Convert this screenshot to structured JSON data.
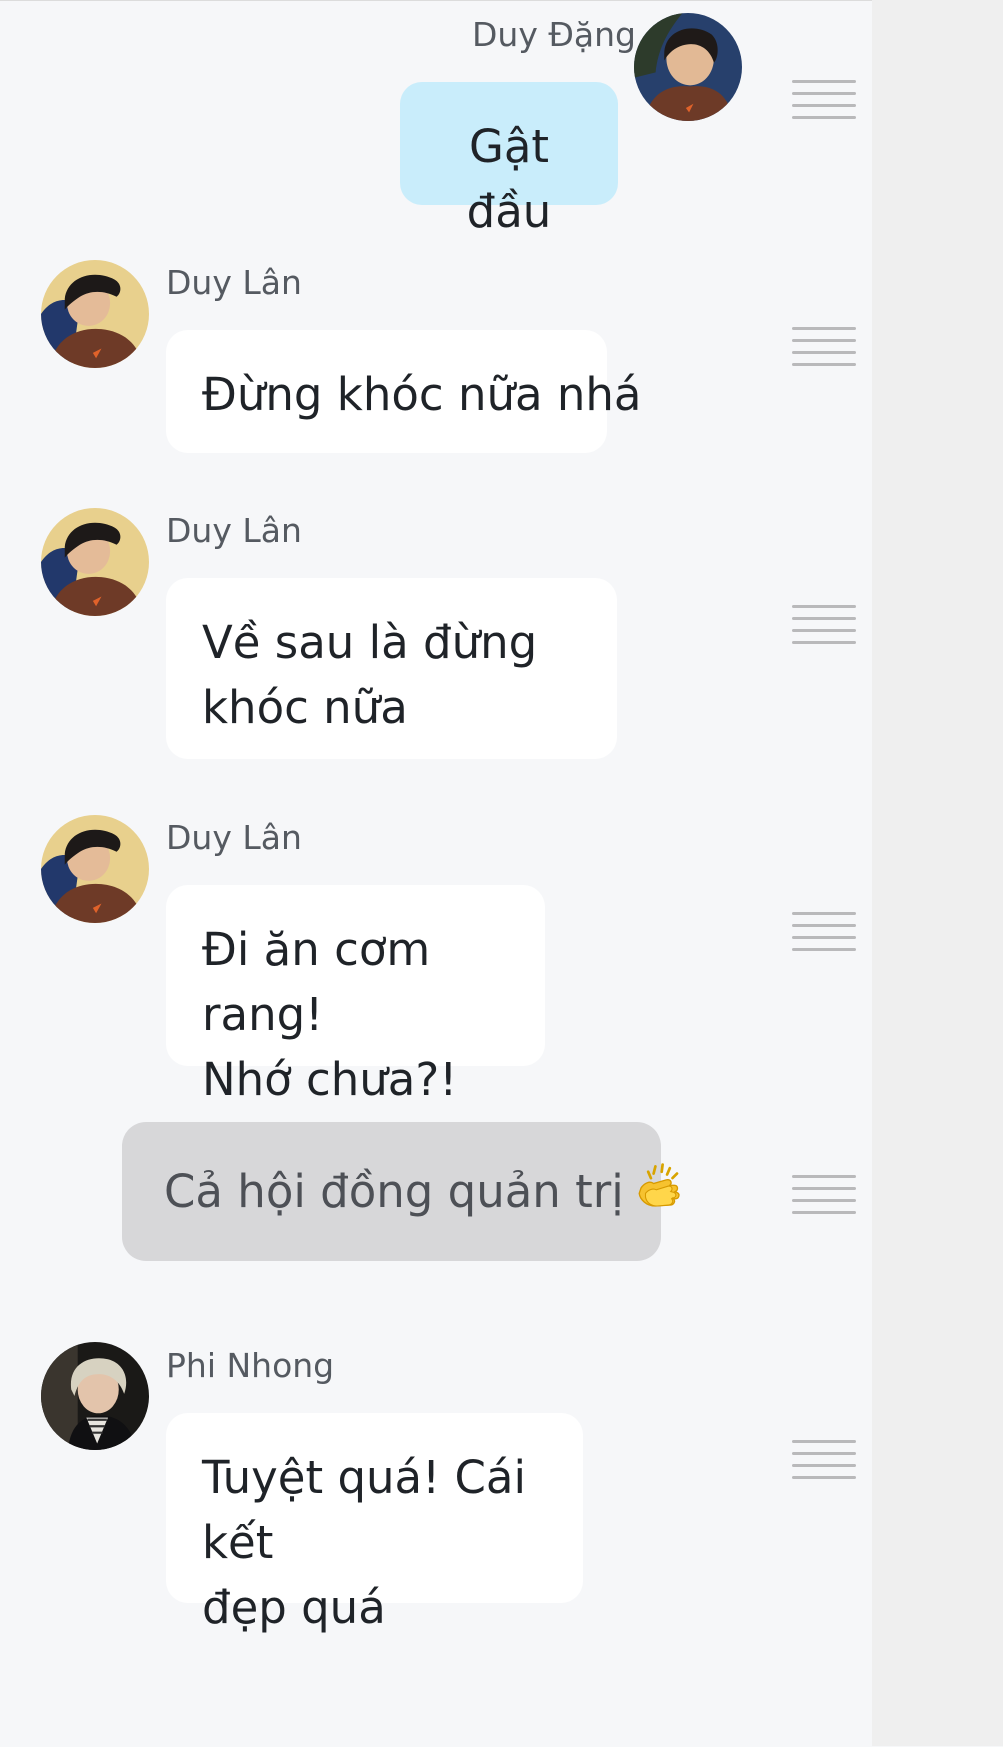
{
  "messages": [
    {
      "sender": "Duy Đặng",
      "text": "Gật đầu",
      "avatar_icon": "boy-profile-photo"
    },
    {
      "sender": "Duy Lân",
      "text": "Đừng khóc nữa nhá",
      "avatar_icon": "boy-profile-photo"
    },
    {
      "sender": "Duy Lân",
      "lines": [
        "Về sau là đừng",
        "khóc nữa"
      ],
      "avatar_icon": "boy-profile-photo"
    },
    {
      "sender": "Duy Lân",
      "lines": [
        "Đi ăn cơm rang!",
        "Nhớ chưa?!"
      ],
      "avatar_icon": "boy-profile-photo"
    },
    {
      "text": "Cả hội đồng quản trị",
      "emoji_icon": "clapping-hands-icon"
    },
    {
      "sender": "Phi Nhong",
      "lines": [
        "Tuyệt quá! Cái kết",
        "đẹp quá"
      ],
      "avatar_icon": "blond-profile-photo"
    }
  ],
  "colors": {
    "background": "#f6f7f9",
    "incoming_bubble": "#ffffff",
    "outgoing_bubble": "#c9edfb",
    "system_bubble": "#d7d7d9",
    "handle_rail": "#efefef"
  },
  "handle_icon": "drag-handle-icon"
}
